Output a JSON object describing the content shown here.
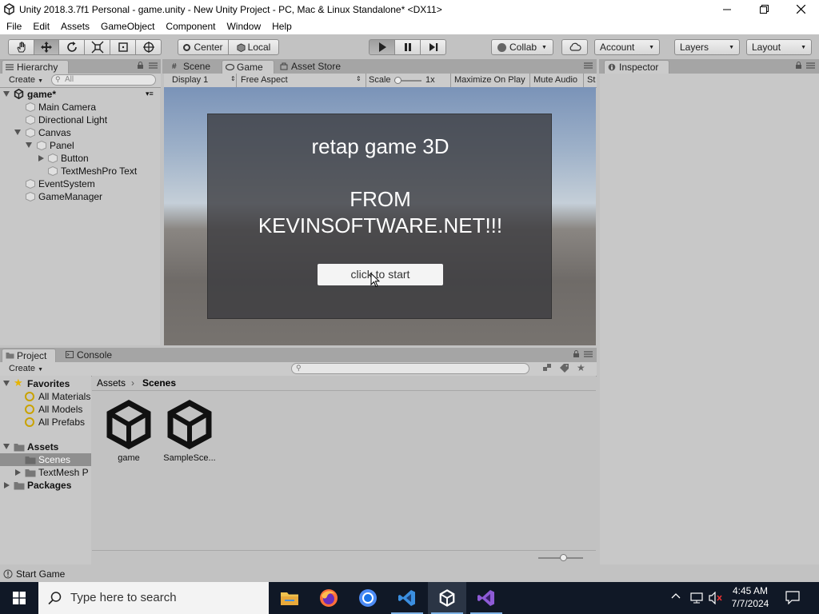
{
  "window": {
    "title": "Unity 2018.3.7f1 Personal - game.unity - New Unity Project - PC, Mac & Linux Standalone* <DX11>"
  },
  "menu": [
    "File",
    "Edit",
    "Assets",
    "GameObject",
    "Component",
    "Window",
    "Help"
  ],
  "toolbar": {
    "center": "Center",
    "local": "Local",
    "collab": "Collab",
    "account": "Account",
    "layers": "Layers",
    "layout": "Layout"
  },
  "hierarchy": {
    "tab": "Hierarchy",
    "create": "Create",
    "search_placeholder": "All",
    "scene": "game*",
    "items": [
      "Main Camera",
      "Directional Light",
      "Canvas",
      "Panel",
      "Button",
      "TextMeshPro Text",
      "EventSystem",
      "GameManager"
    ]
  },
  "center_tabs": {
    "scene": "Scene",
    "game": "Game",
    "asset_store": "Asset Store"
  },
  "game_toolbar": {
    "display": "Display 1",
    "aspect": "Free Aspect",
    "scale_label": "Scale",
    "scale_value": "1x",
    "maximize": "Maximize On Play",
    "mute": "Mute Audio",
    "stats": "St"
  },
  "game": {
    "title": "retap game 3D",
    "from": "FROM",
    "site": "KEVINSOFTWARE.NET!!!",
    "button": "click to start"
  },
  "inspector": {
    "tab": "Inspector"
  },
  "project": {
    "tab": "Project",
    "console_tab": "Console",
    "create": "Create",
    "favorites_label": "Favorites",
    "favorites": [
      "All Materials",
      "All Models",
      "All Prefabs"
    ],
    "assets_label": "Assets",
    "asset_children": [
      "Scenes",
      "TextMesh P"
    ],
    "packages_label": "Packages",
    "breadcrumb": [
      "Assets",
      "Scenes"
    ],
    "files": [
      "game",
      "SampleSce..."
    ]
  },
  "status": {
    "text": "Start Game"
  },
  "taskbar": {
    "search_placeholder": "Type here to search",
    "time": "4:45 AM",
    "date": "7/7/2024"
  },
  "colors": {
    "editor_bg": "#c2c2c2",
    "taskbar_bg": "#101826",
    "selection": "#8f8f8f"
  }
}
